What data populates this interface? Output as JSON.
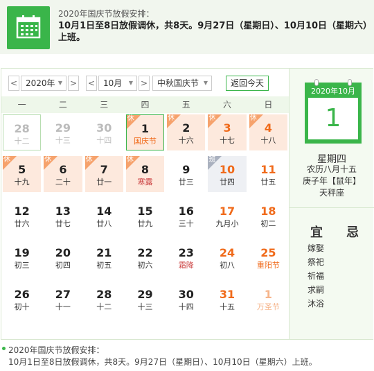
{
  "banner": {
    "title": "2020年国庆节放假安排：",
    "text": "10月1日至8日放假调休，共8天。9月27日（星期日）、10月10日（星期六）上班。",
    "icon": "calendar-icon"
  },
  "toolbar": {
    "prev": "<",
    "next": ">",
    "year": "2020年",
    "month": "10月",
    "holiday": "中秋国庆节",
    "today": "返回今天"
  },
  "weekdays": [
    "一",
    "二",
    "三",
    "四",
    "五",
    "六",
    "日"
  ],
  "days": [
    {
      "n": "28",
      "s": "十二",
      "t": "other"
    },
    {
      "n": "29",
      "s": "十三",
      "t": "other"
    },
    {
      "n": "30",
      "s": "十四",
      "t": "other"
    },
    {
      "n": "1",
      "s": "国庆节",
      "t": "rest festival today",
      "tag": "休"
    },
    {
      "n": "2",
      "s": "十六",
      "t": "rest",
      "tag": "休"
    },
    {
      "n": "3",
      "s": "十七",
      "t": "rest weekend",
      "tag": "休"
    },
    {
      "n": "4",
      "s": "十八",
      "t": "rest weekend",
      "tag": "休"
    },
    {
      "n": "5",
      "s": "十九",
      "t": "rest",
      "tag": "休"
    },
    {
      "n": "6",
      "s": "二十",
      "t": "rest",
      "tag": "休"
    },
    {
      "n": "7",
      "s": "廿一",
      "t": "rest",
      "tag": "休"
    },
    {
      "n": "8",
      "s": "寒露",
      "t": "rest term",
      "tag": "休"
    },
    {
      "n": "9",
      "s": "廿三",
      "t": ""
    },
    {
      "n": "10",
      "s": "廿四",
      "t": "work weekend",
      "tag": "班"
    },
    {
      "n": "11",
      "s": "廿五",
      "t": "weekend"
    },
    {
      "n": "12",
      "s": "廿六",
      "t": ""
    },
    {
      "n": "13",
      "s": "廿七",
      "t": ""
    },
    {
      "n": "14",
      "s": "廿八",
      "t": ""
    },
    {
      "n": "15",
      "s": "廿九",
      "t": ""
    },
    {
      "n": "16",
      "s": "三十",
      "t": ""
    },
    {
      "n": "17",
      "s": "九月小",
      "t": "weekend"
    },
    {
      "n": "18",
      "s": "初二",
      "t": "weekend"
    },
    {
      "n": "19",
      "s": "初三",
      "t": ""
    },
    {
      "n": "20",
      "s": "初四",
      "t": ""
    },
    {
      "n": "21",
      "s": "初五",
      "t": ""
    },
    {
      "n": "22",
      "s": "初六",
      "t": ""
    },
    {
      "n": "23",
      "s": "霜降",
      "t": "term"
    },
    {
      "n": "24",
      "s": "初八",
      "t": "weekend"
    },
    {
      "n": "25",
      "s": "重阳节",
      "t": "weekend festival"
    },
    {
      "n": "26",
      "s": "初十",
      "t": ""
    },
    {
      "n": "27",
      "s": "十一",
      "t": ""
    },
    {
      "n": "28",
      "s": "十二",
      "t": ""
    },
    {
      "n": "29",
      "s": "十三",
      "t": ""
    },
    {
      "n": "30",
      "s": "十四",
      "t": ""
    },
    {
      "n": "31",
      "s": "十五",
      "t": "weekend"
    },
    {
      "n": "1",
      "s": "万圣节",
      "t": "other otherfest"
    }
  ],
  "side": {
    "header": "2020年10月",
    "day": "1",
    "weekday": "星期四",
    "lunar": "农历八月十五",
    "ganzhi": "庚子年【鼠年】",
    "star": "天秤座",
    "yi": "宜",
    "ji": "忌",
    "yi_items": [
      "嫁娶",
      "祭祀",
      "祈福",
      "求嗣",
      "沐浴"
    ]
  },
  "footer": {
    "title": "2020年国庆节放假安排：",
    "text": "10月1日至8日放假调休，共8天。9月27日（星期日）、10月10日（星期六）上班。"
  },
  "colors": {
    "accent": "#3ab54a",
    "holiday": "#f06a1a",
    "rest_bg": "#fde9dd"
  }
}
